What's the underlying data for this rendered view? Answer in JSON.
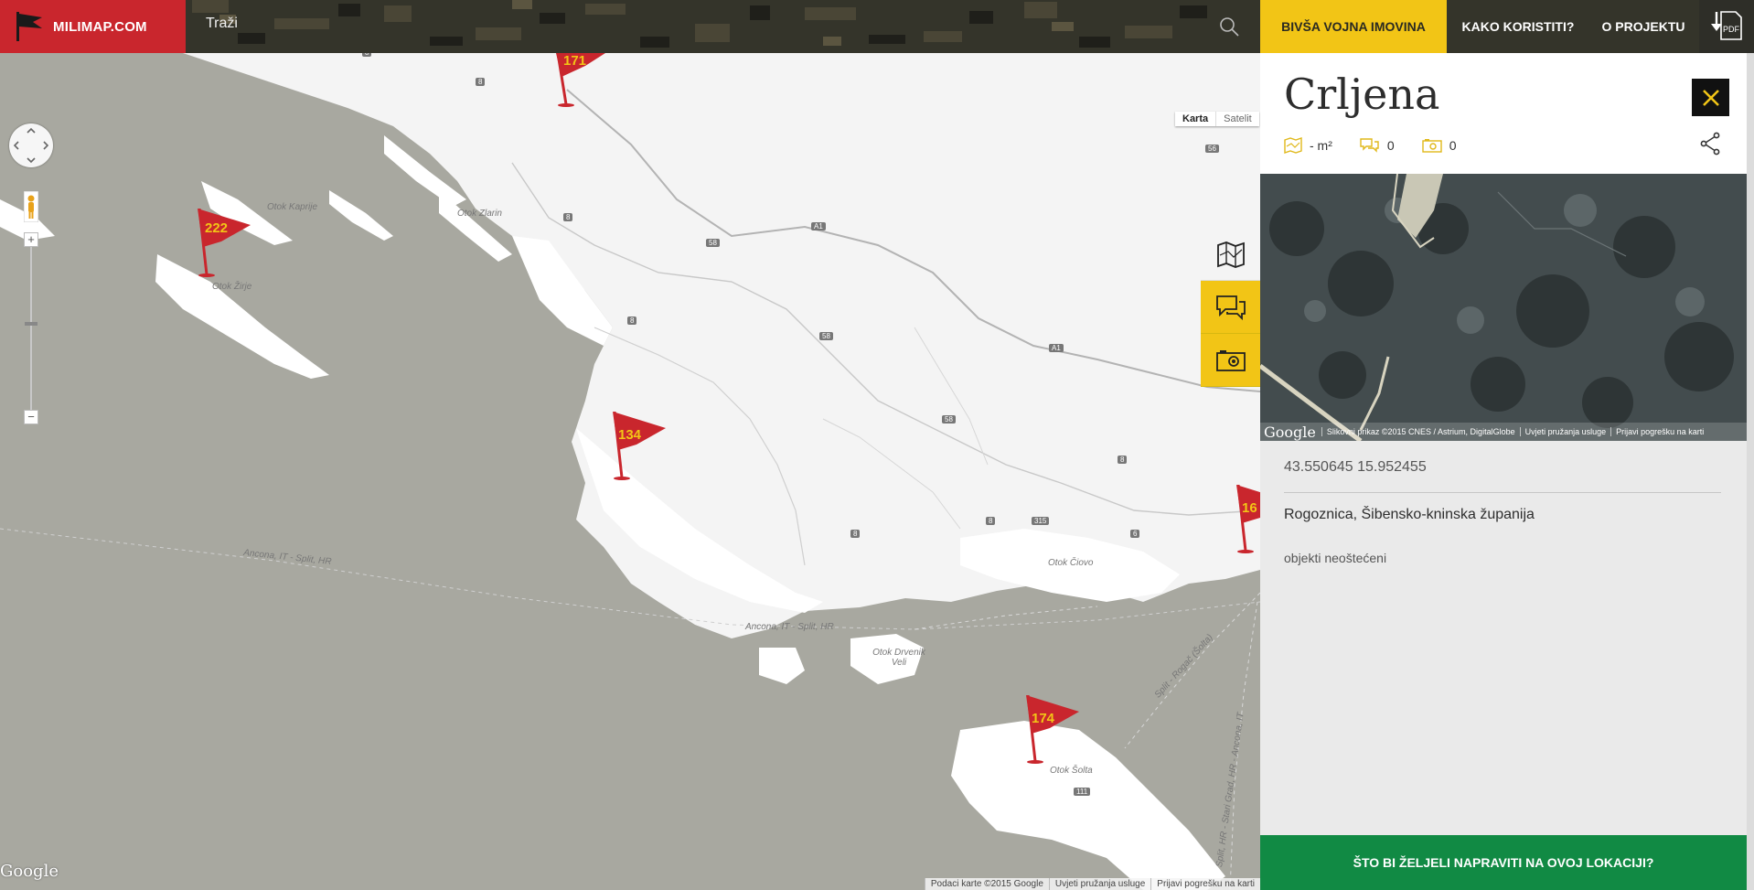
{
  "brand": {
    "name": "MILIMAP.COM"
  },
  "search": {
    "label": "Traži"
  },
  "nav": {
    "items": [
      {
        "label": "BIVŠA VOJNA IMOVINA",
        "active": true
      },
      {
        "label": "KAKO KORISTITI?",
        "active": false
      },
      {
        "label": "O PROJEKTU",
        "active": false
      }
    ],
    "pdf_label": "PDF"
  },
  "map": {
    "type_buttons": {
      "karta": "Karta",
      "satelit": "Satelit"
    },
    "zoom": {
      "plus": "+",
      "minus": "−"
    },
    "google_mark": "Google",
    "attribution": [
      "Podaci karte ©2015 Google",
      "Uvjeti pružanja usluge",
      "Prijavi pogrešku na karti"
    ],
    "pins": [
      {
        "number": "171"
      },
      {
        "number": "222"
      },
      {
        "number": "134"
      },
      {
        "number": "16"
      },
      {
        "number": "174"
      }
    ],
    "labels": {
      "otok_kaprije": "Otok Kaprije",
      "otok_zlarin": "Otok Zlarin",
      "otok_zirje": "Otok Žirje",
      "otok_ciovo": "Otok Čiovo",
      "otok_drvenik": "Otok Drvenik Veli",
      "otok_solta": "Otok Šolta",
      "ferry1": "Ancona, IT - Split, HR",
      "ferry2": "Ancona, IT - Split, HR",
      "ferry3": "Split - Rogač (Šolta)",
      "ferry4": "Split, HR - Stari Grad, HR - Ancona, IT"
    },
    "road_numbers": [
      "8",
      "8",
      "8",
      "8",
      "8",
      "8",
      "8",
      "58",
      "58",
      "58",
      "A1",
      "A1",
      "56",
      "315",
      "111",
      "6"
    ]
  },
  "panel": {
    "title": "Crljena",
    "area": "- m²",
    "comments": "0",
    "photos": "0",
    "photo_attribution": {
      "google": "Google",
      "imagery": "Slikovni prikaz ©2015 CNES / Astrium, DigitalGlobe",
      "terms": "Uvjeti pružanja usluge",
      "report": "Prijavi pogrešku na karti"
    },
    "coordinates": "43.550645 15.952455",
    "place": "Rogoznica, Šibensko-kninska županija",
    "status": "objekti neoštećeni",
    "cta_label": "ŠTO BI ŽELJELI NAPRAVITI NA OVOJ LOKACIJI?"
  },
  "colors": {
    "brand_red": "#c9262d",
    "accent_yellow": "#f2c516",
    "cta_green": "#118a44",
    "topbar": "#2a2a22",
    "sea": "#a8a8a0",
    "land": "#ffffff"
  }
}
